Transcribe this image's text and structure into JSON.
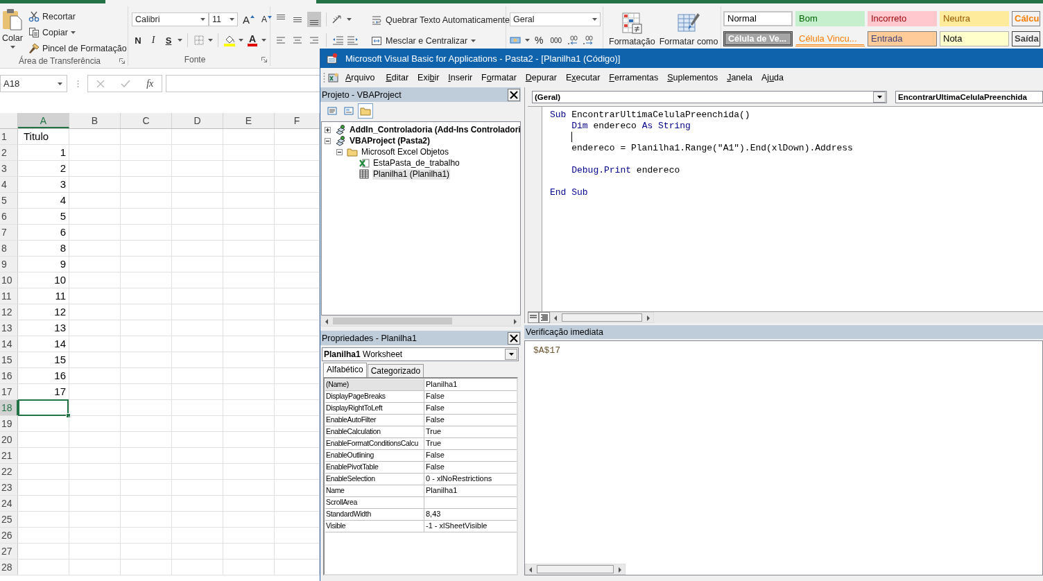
{
  "excel": {
    "ribbon": {
      "clipboard": {
        "paste": "Colar",
        "cut": "Recortar",
        "copy": "Copiar",
        "format_painter": "Pincel de Formatação",
        "label": "Área de Transferência"
      },
      "font": {
        "name": "Calibri",
        "size": "11",
        "grow": "A",
        "shrink": "A",
        "bold": "N",
        "italic": "I",
        "underline": "S",
        "font_color": "A",
        "label": "Fonte"
      },
      "alignment": {
        "vertical": [
          {
            "kind": "top",
            "selected": false
          },
          {
            "kind": "middle",
            "selected": false
          },
          {
            "kind": "bottom",
            "selected": true
          }
        ],
        "wrap_text": "Quebrar Texto Automaticamente",
        "merge": "Mesclar e Centralizar"
      },
      "number": {
        "format": "Geral",
        "percent": "%",
        "thousands": "000"
      },
      "conditional_formatting": "Formatação",
      "format_as_table": "Formatar como",
      "styles": [
        {
          "label": "Normal",
          "kind": "normal"
        },
        {
          "label": "Bom",
          "kind": "good"
        },
        {
          "label": "Incorreto",
          "kind": "bad"
        },
        {
          "label": "Neutra",
          "kind": "neutral"
        },
        {
          "label": "Cálcu",
          "kind": "calculation"
        },
        {
          "label": "Célula de Ve...",
          "kind": "check"
        },
        {
          "label": "Célula Vincu...",
          "kind": "linked"
        },
        {
          "label": "Entrada",
          "kind": "input"
        },
        {
          "label": "Nota",
          "kind": "note"
        },
        {
          "label": "Saída",
          "kind": "output"
        }
      ]
    },
    "formula_bar": {
      "name_box": "A18",
      "function": "fx"
    },
    "sheet": {
      "columns": [
        {
          "label": "A",
          "selected": true
        },
        {
          "label": "B",
          "selected": false
        },
        {
          "label": "C",
          "selected": false
        },
        {
          "label": "D",
          "selected": false
        },
        {
          "label": "E",
          "selected": false
        },
        {
          "label": "F",
          "selected": false
        }
      ],
      "rows": [
        {
          "number": "1",
          "selected": false,
          "value": "Titulo",
          "kind": "text"
        },
        {
          "number": "2",
          "selected": false,
          "value": "1",
          "kind": "number"
        },
        {
          "number": "3",
          "selected": false,
          "value": "2",
          "kind": "number"
        },
        {
          "number": "4",
          "selected": false,
          "value": "3",
          "kind": "number"
        },
        {
          "number": "5",
          "selected": false,
          "value": "4",
          "kind": "number"
        },
        {
          "number": "6",
          "selected": false,
          "value": "5",
          "kind": "number"
        },
        {
          "number": "7",
          "selected": false,
          "value": "6",
          "kind": "number"
        },
        {
          "number": "8",
          "selected": false,
          "value": "8",
          "kind": "number"
        },
        {
          "number": "9",
          "selected": false,
          "value": "9",
          "kind": "number"
        },
        {
          "number": "10",
          "selected": false,
          "value": "10",
          "kind": "number"
        },
        {
          "number": "11",
          "selected": false,
          "value": "11",
          "kind": "number"
        },
        {
          "number": "12",
          "selected": false,
          "value": "12",
          "kind": "number"
        },
        {
          "number": "13",
          "selected": false,
          "value": "13",
          "kind": "number"
        },
        {
          "number": "14",
          "selected": false,
          "value": "14",
          "kind": "number"
        },
        {
          "number": "15",
          "selected": false,
          "value": "15",
          "kind": "number"
        },
        {
          "number": "16",
          "selected": false,
          "value": "16",
          "kind": "number"
        },
        {
          "number": "17",
          "selected": false,
          "value": "17",
          "kind": "number"
        },
        {
          "number": "18",
          "selected": true
        },
        {
          "number": "19",
          "selected": false
        },
        {
          "number": "20",
          "selected": false
        },
        {
          "number": "21",
          "selected": false
        },
        {
          "number": "22",
          "selected": false
        },
        {
          "number": "23",
          "selected": false
        },
        {
          "number": "24",
          "selected": false
        },
        {
          "number": "25",
          "selected": false
        },
        {
          "number": "26",
          "selected": false
        },
        {
          "number": "27",
          "selected": false
        },
        {
          "number": "28",
          "selected": false
        }
      ]
    }
  },
  "vba": {
    "title": "Microsoft Visual Basic for Applications - Pasta2 - [Planilha1 (Código)]",
    "menu": [
      {
        "key": "A",
        "post": "rquivo"
      },
      {
        "key": "E",
        "post": "ditar"
      },
      {
        "pre": "Exi",
        "key": "b",
        "post": "ir"
      },
      {
        "key": "I",
        "post": "nserir"
      },
      {
        "pre": "F",
        "key": "o",
        "post": "rmatar"
      },
      {
        "key": "D",
        "post": "epurar"
      },
      {
        "pre": "E",
        "key": "x",
        "post": "ecutar"
      },
      {
        "key": "F",
        "post": "erramentas"
      },
      {
        "key": "S",
        "post": "uplementos"
      },
      {
        "key": "J",
        "post": "anela"
      },
      {
        "pre": "Aj",
        "key": "u",
        "post": "da"
      }
    ],
    "project": {
      "title": "Projeto - VBAProject",
      "toolbar": [
        {
          "kind": "view-code",
          "selected": false
        },
        {
          "kind": "view-object",
          "selected": false
        },
        {
          "kind": "toggle-folders",
          "selected": true
        }
      ],
      "tree": [
        {
          "label": "AddIn_Controladoria (Add-Ins Controladori",
          "kind": "project",
          "expanded": false,
          "selected": false
        },
        {
          "label": "VBAProject (Pasta2)",
          "kind": "project",
          "expanded": true,
          "selected": false,
          "children": [
            {
              "label": "Microsoft Excel Objetos",
              "kind": "folder",
              "expanded": true,
              "selected": false,
              "children": [
                {
                  "label": "EstaPasta_de_trabalho",
                  "kind": "workbook",
                  "selected": false
                },
                {
                  "label": "Planilha1 (Planilha1)",
                  "kind": "sheet",
                  "selected": true
                }
              ]
            }
          ]
        }
      ]
    },
    "properties": {
      "title": "Propriedades - Planilha1",
      "object_name": "Planilha1",
      "object_type": "Worksheet",
      "tabs": [
        {
          "label": "Alfabético",
          "selected": true
        },
        {
          "label": "Categorizado",
          "selected": false
        }
      ],
      "rows": [
        {
          "name": "(Name)",
          "value": "Planilha1",
          "selected": true
        },
        {
          "name": "DisplayPageBreaks",
          "value": "False",
          "selected": false
        },
        {
          "name": "DisplayRightToLeft",
          "value": "False",
          "selected": false
        },
        {
          "name": "EnableAutoFilter",
          "value": "False",
          "selected": false
        },
        {
          "name": "EnableCalculation",
          "value": "True",
          "selected": false
        },
        {
          "name": "EnableFormatConditionsCalcu",
          "value": "True",
          "selected": false
        },
        {
          "name": "EnableOutlining",
          "value": "False",
          "selected": false
        },
        {
          "name": "EnablePivotTable",
          "value": "False",
          "selected": false
        },
        {
          "name": "EnableSelection",
          "value": "0 - xlNoRestrictions",
          "selected": false
        },
        {
          "name": "Name",
          "value": "Planilha1",
          "selected": false
        },
        {
          "name": "ScrollArea",
          "selected": false
        },
        {
          "name": "StandardWidth",
          "value": "8,43",
          "selected": false
        },
        {
          "name": "Visible",
          "value": "-1 - xlSheetVisible",
          "selected": false
        }
      ]
    },
    "code": {
      "object": "(Geral)",
      "procedure": "EncontrarUltimaCelulaPreenchida",
      "lines": [
        {
          "kind": "code",
          "tokens": [
            {
              "kind": "keyword",
              "text": "Sub"
            },
            {
              "kind": "plain",
              "text": " EncontrarUltimaCelulaPreenchida()"
            }
          ]
        },
        {
          "kind": "code",
          "tokens": [
            {
              "kind": "keyword",
              "text": "    Dim"
            },
            {
              "kind": "plain",
              "text": " endereco "
            },
            {
              "kind": "keyword",
              "text": "As String"
            }
          ]
        },
        {
          "kind": "caret"
        },
        {
          "kind": "code",
          "tokens": [
            {
              "kind": "plain",
              "text": "    endereco = Planilha1.Range(\"A1\").End(xlDown).Address"
            }
          ]
        },
        {
          "kind": "blank"
        },
        {
          "kind": "code",
          "tokens": [
            {
              "kind": "keyword",
              "text": "    Debug.Print"
            },
            {
              "kind": "plain",
              "text": " endereco"
            }
          ]
        },
        {
          "kind": "blank"
        },
        {
          "kind": "code",
          "tokens": [
            {
              "kind": "keyword",
              "text": "End Sub"
            }
          ]
        }
      ]
    },
    "immediate": {
      "title": "Verificação imediata",
      "lines": [
        "$A$17"
      ]
    }
  }
}
